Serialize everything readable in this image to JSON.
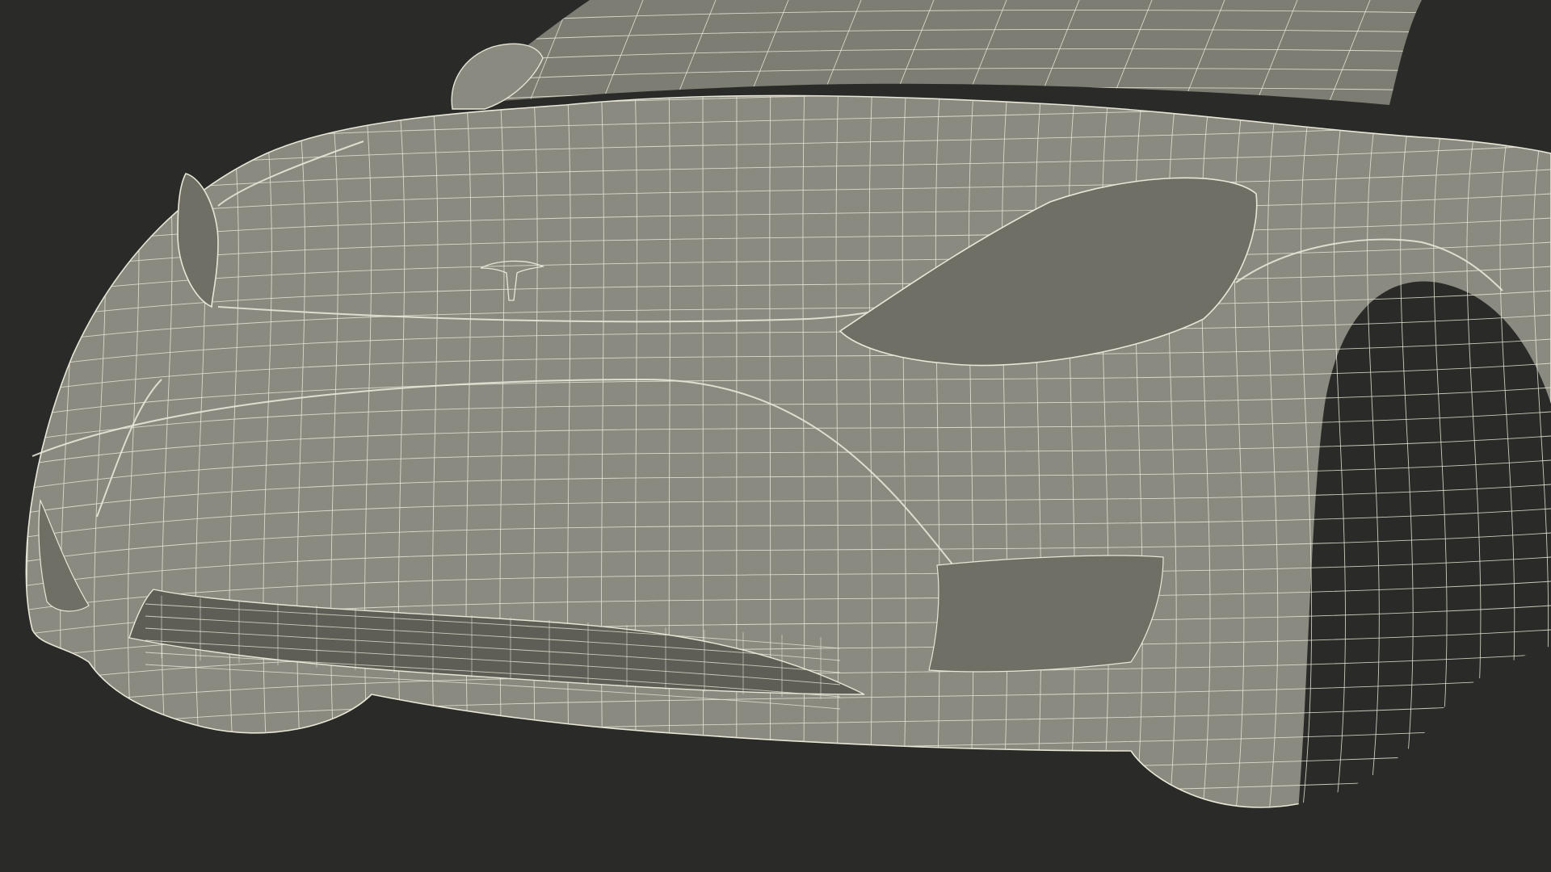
{
  "scene": {
    "subject": "car-front-wireframe-render",
    "colors": {
      "background": "#2a2a28",
      "body": "#8a8a80",
      "body_dark": "#6f6f66",
      "glass": "#7d7d74",
      "wire": "#e8e6d6",
      "grille": "#5e5e56",
      "tire": "#55554e",
      "rim": "#7a7a71"
    },
    "icons": {
      "emblem": "brand-logo-icon"
    }
  }
}
